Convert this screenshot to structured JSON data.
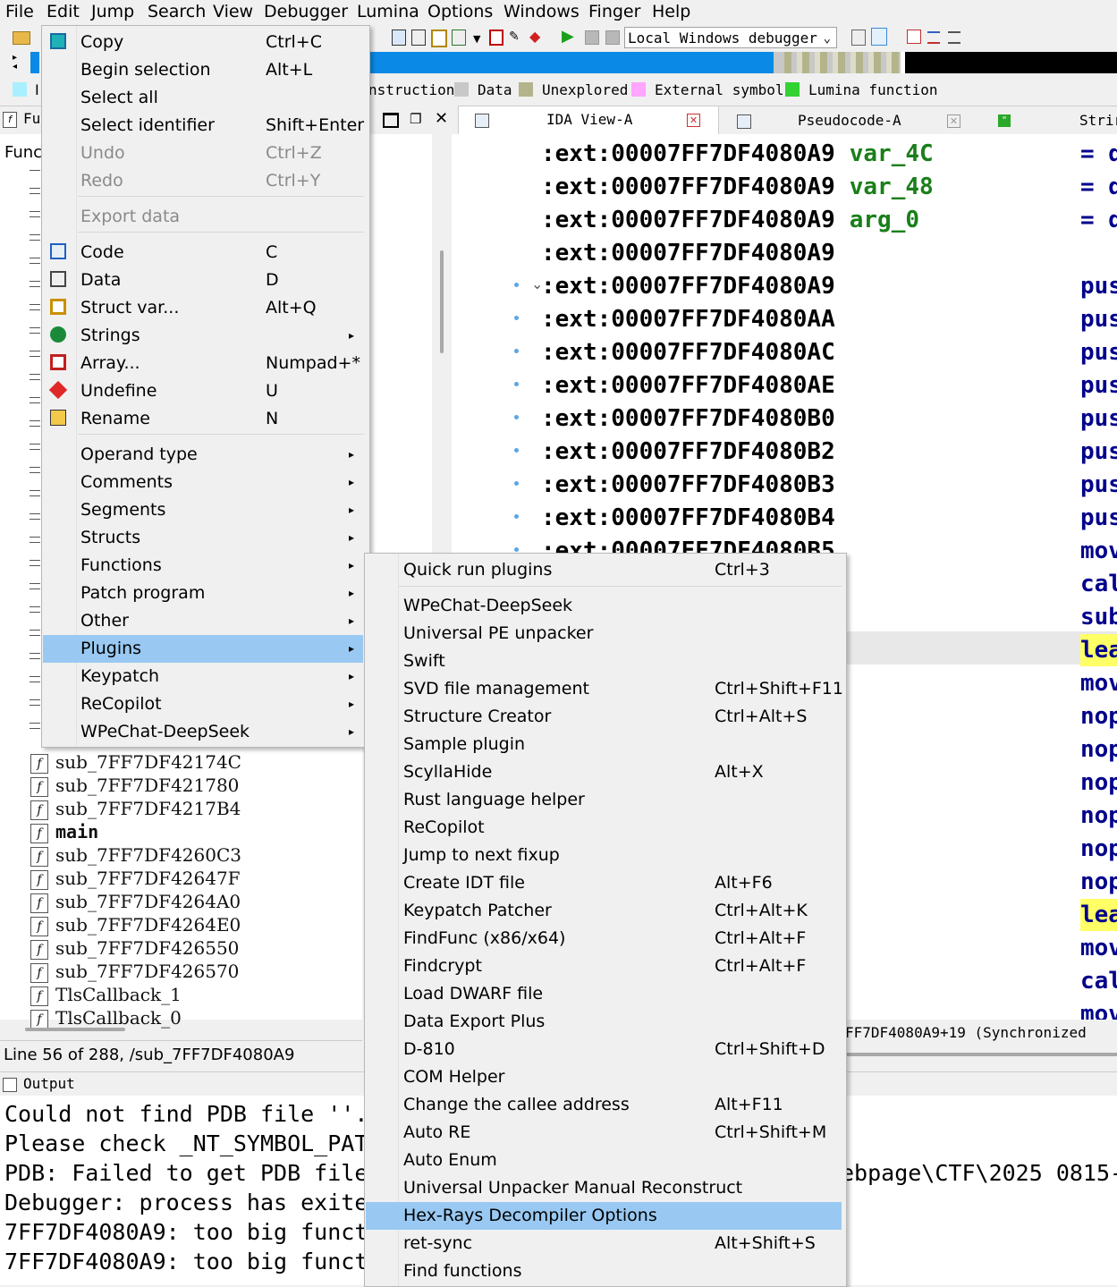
{
  "menubar": [
    "File",
    "Edit",
    "Jump",
    "Search",
    "View",
    "Debugger",
    "Lumina",
    "Options",
    "Windows",
    "Finger",
    "Help"
  ],
  "toolbar": {
    "debugger_select": "Local Windows debugger"
  },
  "legend": [
    {
      "label": "nstruction",
      "color": "#c0c0c0"
    },
    {
      "label": "Data",
      "color": "#c8c8c8"
    },
    {
      "label": "Unexplored",
      "color": "#b4b48c"
    },
    {
      "label": "External symbol",
      "color": "#ffa6ff"
    },
    {
      "label": "Lumina function",
      "color": "#32d232"
    }
  ],
  "left_tabs": {
    "functions_short": "Fu",
    "functions_header": "Func"
  },
  "tabs": [
    {
      "label": "IDA View-A"
    },
    {
      "label": "Pseudocode-A"
    },
    {
      "label": "Strir"
    }
  ],
  "edit_menu": [
    {
      "label": "Copy",
      "shortcut": "Ctrl+C",
      "disabled": false,
      "icon": "copy-icon"
    },
    {
      "label": "Begin selection",
      "shortcut": "Alt+L",
      "disabled": false
    },
    {
      "label": "Select all",
      "shortcut": "",
      "disabled": false
    },
    {
      "label": "Select identifier",
      "shortcut": "Shift+Enter",
      "disabled": false
    },
    {
      "label": "Undo",
      "shortcut": "Ctrl+Z",
      "disabled": true
    },
    {
      "label": "Redo",
      "shortcut": "Ctrl+Y",
      "disabled": true
    },
    {
      "label": "Export data",
      "shortcut": "",
      "disabled": true
    },
    {
      "label": "Code",
      "shortcut": "C",
      "disabled": false,
      "icon": "code-icon"
    },
    {
      "label": "Data",
      "shortcut": "D",
      "disabled": false,
      "icon": "data-icon"
    },
    {
      "label": "Struct var...",
      "shortcut": "Alt+Q",
      "disabled": false,
      "icon": "struct-icon"
    },
    {
      "label": "Strings",
      "shortcut": "",
      "disabled": false,
      "icon": "strings-icon",
      "submenu": true
    },
    {
      "label": "Array...",
      "shortcut": "Numpad+*",
      "disabled": false,
      "icon": "array-icon"
    },
    {
      "label": "Undefine",
      "shortcut": "U",
      "disabled": false,
      "icon": "undefine-icon"
    },
    {
      "label": "Rename",
      "shortcut": "N",
      "disabled": false,
      "icon": "rename-icon"
    },
    {
      "label": "Operand type",
      "submenu": true
    },
    {
      "label": "Comments",
      "submenu": true
    },
    {
      "label": "Segments",
      "submenu": true
    },
    {
      "label": "Structs",
      "submenu": true
    },
    {
      "label": "Functions",
      "submenu": true
    },
    {
      "label": "Patch program",
      "submenu": true
    },
    {
      "label": "Other",
      "submenu": true
    },
    {
      "label": "Plugins",
      "submenu": true,
      "highlighted": true
    },
    {
      "label": "Keypatch",
      "submenu": true
    },
    {
      "label": "ReCopilot",
      "submenu": true
    },
    {
      "label": "WPeChat-DeepSeek",
      "submenu": true
    }
  ],
  "plugins_menu": [
    {
      "label": "Quick run plugins",
      "shortcut": "Ctrl+3"
    },
    {
      "label": "WPeChat-DeepSeek",
      "shortcut": ""
    },
    {
      "label": "Universal PE unpacker",
      "shortcut": ""
    },
    {
      "label": "Swift",
      "shortcut": ""
    },
    {
      "label": "SVD file management",
      "shortcut": "Ctrl+Shift+F11"
    },
    {
      "label": "Structure Creator",
      "shortcut": "Ctrl+Alt+S"
    },
    {
      "label": "Sample plugin",
      "shortcut": ""
    },
    {
      "label": "ScyllaHide",
      "shortcut": "Alt+X"
    },
    {
      "label": "Rust language helper",
      "shortcut": ""
    },
    {
      "label": "ReCopilot",
      "shortcut": ""
    },
    {
      "label": "Jump to next fixup",
      "shortcut": ""
    },
    {
      "label": "Create IDT file",
      "shortcut": "Alt+F6"
    },
    {
      "label": "Keypatch Patcher",
      "shortcut": "Ctrl+Alt+K"
    },
    {
      "label": "FindFunc (x86/x64)",
      "shortcut": "Ctrl+Alt+F"
    },
    {
      "label": "Findcrypt",
      "shortcut": "Ctrl+Alt+F"
    },
    {
      "label": "Load DWARF file",
      "shortcut": ""
    },
    {
      "label": "Data Export Plus",
      "shortcut": ""
    },
    {
      "label": "D-810",
      "shortcut": "Ctrl+Shift+D"
    },
    {
      "label": "COM Helper",
      "shortcut": ""
    },
    {
      "label": "Change the callee address",
      "shortcut": "Alt+F11"
    },
    {
      "label": "Auto RE",
      "shortcut": "Ctrl+Shift+M"
    },
    {
      "label": "Auto Enum",
      "shortcut": ""
    },
    {
      "label": "Universal Unpacker Manual Reconstruct",
      "shortcut": ""
    },
    {
      "label": "Hex-Rays Decompiler Options",
      "shortcut": "",
      "highlighted": true
    },
    {
      "label": "ret-sync",
      "shortcut": "Alt+Shift+S"
    },
    {
      "label": "Find functions",
      "shortcut": ""
    }
  ],
  "functions": [
    {
      "name": "sub_7FF7DF42174C",
      "bold": false
    },
    {
      "name": "sub_7FF7DF421780",
      "bold": false
    },
    {
      "name": "sub_7FF7DF4217B4",
      "bold": false
    },
    {
      "name": "main",
      "bold": true
    },
    {
      "name": "sub_7FF7DF4260C3",
      "bold": false
    },
    {
      "name": "sub_7FF7DF42647F",
      "bold": false
    },
    {
      "name": "sub_7FF7DF4264A0",
      "bold": false
    },
    {
      "name": "sub_7FF7DF4264E0",
      "bold": false
    },
    {
      "name": "sub_7FF7DF426550",
      "bold": false
    },
    {
      "name": "sub_7FF7DF426570",
      "bold": false
    },
    {
      "name": "TlsCallback_1",
      "bold": false
    },
    {
      "name": "TlsCallback_0",
      "bold": false
    }
  ],
  "disasm": [
    {
      "addr": ":ext:00007FF7DF4080A9",
      "var": "var_4C",
      "mn": "= d",
      "dot": false
    },
    {
      "addr": ":ext:00007FF7DF4080A9",
      "var": "var_48",
      "mn": "= d",
      "dot": false
    },
    {
      "addr": ":ext:00007FF7DF4080A9",
      "var": "arg_0",
      "mn": "= q",
      "dot": false
    },
    {
      "addr": ":ext:00007FF7DF4080A9",
      "var": "",
      "mn": "",
      "dot": false
    },
    {
      "addr": ":ext:00007FF7DF4080A9",
      "var": "",
      "mn": "pus",
      "dot": true
    },
    {
      "addr": ":ext:00007FF7DF4080AA",
      "var": "",
      "mn": "pus",
      "dot": true
    },
    {
      "addr": ":ext:00007FF7DF4080AC",
      "var": "",
      "mn": "pus",
      "dot": true
    },
    {
      "addr": ":ext:00007FF7DF4080AE",
      "var": "",
      "mn": "pus",
      "dot": true
    },
    {
      "addr": ":ext:00007FF7DF4080B0",
      "var": "",
      "mn": "pus",
      "dot": true
    },
    {
      "addr": ":ext:00007FF7DF4080B2",
      "var": "",
      "mn": "pus",
      "dot": true
    },
    {
      "addr": ":ext:00007FF7DF4080B3",
      "var": "",
      "mn": "pus",
      "dot": true
    },
    {
      "addr": ":ext:00007FF7DF4080B4",
      "var": "",
      "mn": "pus",
      "dot": true
    },
    {
      "addr": ":ext:00007FF7DF4080B5",
      "var": "",
      "mn": "mov",
      "dot": true
    }
  ],
  "disasm_right": [
    "cal",
    "sub",
    "lea",
    "mov",
    "nop",
    "nop",
    "nop",
    "nop",
    "nop",
    "nop",
    "lea",
    "mov",
    "cal",
    "mov"
  ],
  "status": {
    "line": "Line 56 of 288, /sub_7FF7DF4080A9",
    "sync": "FF7DF4080A9+19 (Synchronized"
  },
  "output": {
    "title": "Output",
    "lines": [
      "Could not find PDB file ''.",
      "Please check _NT_SYMBOL_PAT",
      "PDB: Failed to get PDB file",
      "Debugger: process has exite",
      "7FF7DF4080A9: too big funct",
      "7FF7DF4080A9: too big funct"
    ],
    "right_fragment": "ebpage\\CTF\\2025 0815-"
  }
}
